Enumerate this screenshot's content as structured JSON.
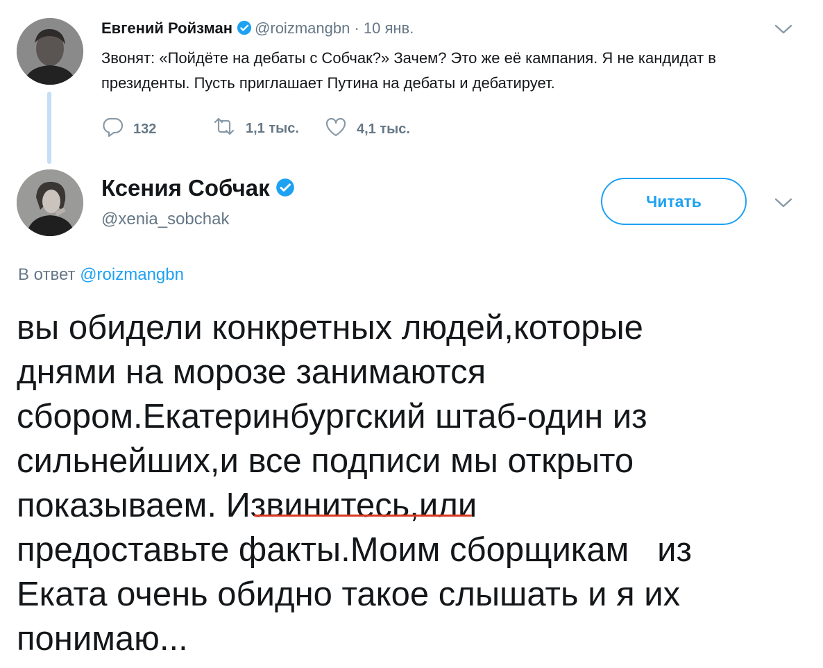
{
  "tweet1": {
    "author_name": "Евгений Ройзман",
    "handle": "@roizmangbn",
    "separator": "·",
    "date": "10 янв.",
    "text": "Звонят: «Пойдёте на дебаты с Собчак?» Зачем? Это же её кампания. Я не кандидат в президенты. Пусть приглашает Путина на дебаты и дебатирует.",
    "replies_count": "132",
    "retweets_count": "1,1 тыс.",
    "likes_count": "4,1 тыс."
  },
  "tweet2": {
    "author_name": "Ксения Собчак",
    "handle": "@xenia_sobchak",
    "follow_label": "Читать",
    "reply_prefix": "В ответ",
    "reply_mention": "@roizmangbn",
    "text": "вы обидели конкретных людей,которые\nднями на морозе занимаются\nсбором.Екатеринбургский штаб-один из\nсильнейших,и все подписи мы открыто\nпоказываем. Извинитесь,или\nпредоставьте факты.Моим сборщикам   из\nЕката очень обидно такое слышать и я их\nпонимаю..."
  },
  "colors": {
    "accent": "#1da1f2",
    "muted": "#657786",
    "thread_line": "#c4dff5",
    "underline_mark": "#d93a1f"
  },
  "icons": [
    "verified-badge-icon",
    "chevron-down-icon",
    "reply-icon",
    "retweet-icon",
    "like-icon"
  ]
}
